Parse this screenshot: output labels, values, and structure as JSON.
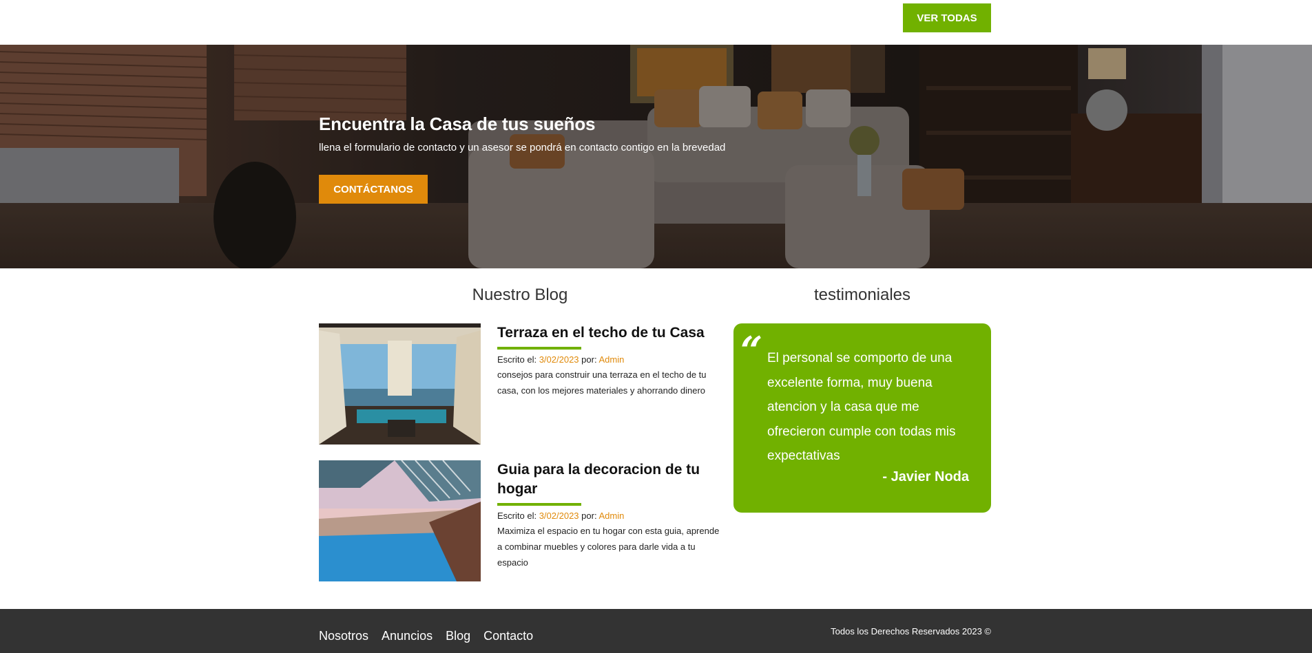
{
  "header": {
    "view_all_label": "VER TODAS"
  },
  "hero": {
    "title": "Encuentra la Casa de tus sueños",
    "subtitle": "llena el formulario de contacto y un asesor se pondrá en contacto contigo en la brevedad",
    "button_label": "CONTÁCTANOS"
  },
  "blog": {
    "title": "Nuestro Blog",
    "entries": [
      {
        "title": "Terraza en el techo de tu Casa",
        "written_label": "Escrito el:",
        "date": "3/02/2023",
        "by_label": "por:",
        "author": "Admin",
        "text": "consejos para construir una terraza en el techo de tu casa, con los mejores materiales y ahorrando dinero"
      },
      {
        "title": "Guia para la decoracion de tu hogar",
        "written_label": "Escrito el:",
        "date": "3/02/2023",
        "by_label": "por:",
        "author": "Admin",
        "text": "Maximiza el espacio en tu hogar con esta guia, aprende a combinar muebles y colores para darle vida a tu espacio"
      }
    ]
  },
  "testimonials": {
    "title": "testimoniales",
    "quote": "El personal se comporto de una excelente forma, muy buena atencion y la casa que me ofrecieron cumple con todas mis expectativas",
    "author": "- Javier Noda"
  },
  "footer": {
    "nav": [
      "Nosotros",
      "Anuncios",
      "Blog",
      "Contacto"
    ],
    "copyright": "Todos los Derechos Reservados 2023 ©"
  },
  "colors": {
    "accent_green": "#71b100",
    "accent_orange": "#e08a0b",
    "footer_bg": "#333333"
  }
}
